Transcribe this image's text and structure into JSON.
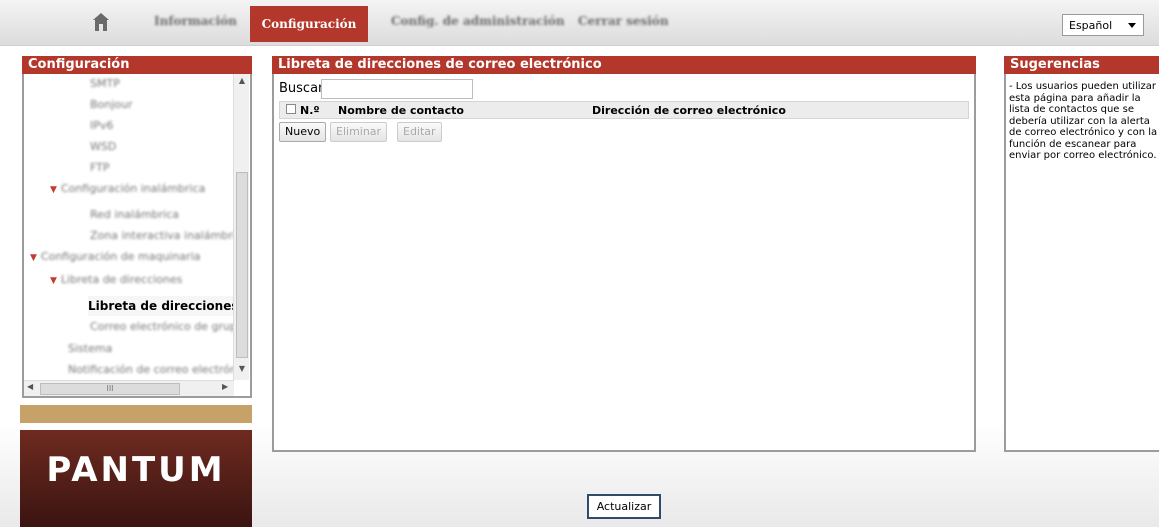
{
  "nav": {
    "home_icon": "home-icon",
    "items": [
      "Información",
      "Configuración",
      "Config. de administración",
      "Cerrar sesión"
    ],
    "active": "Configuración",
    "language": "Español"
  },
  "left": {
    "title": "Configuración",
    "tree": [
      {
        "label": "SMTP",
        "blur": true
      },
      {
        "label": "Bonjour",
        "blur": true
      },
      {
        "label": "IPv6",
        "blur": true
      },
      {
        "label": "WSD",
        "blur": true
      },
      {
        "label": "FTP",
        "blur": true
      },
      {
        "label": "Configuración inalámbrica",
        "blur": true
      },
      {
        "label": "Red inalámbrica",
        "blur": true
      },
      {
        "label": "Zona interactiva inalámbrica",
        "blur": true
      },
      {
        "label": "Configuración de maquinaria",
        "blur": true
      },
      {
        "label": "Libreta de direcciones",
        "blur": true
      },
      {
        "label": "Libreta de direcciones de",
        "blur": false
      },
      {
        "label": "Correo electrónico de grupo",
        "blur": true
      },
      {
        "label": "Sistema",
        "blur": true
      },
      {
        "label": "Notificación de correo electrónico",
        "blur": true
      }
    ],
    "scroll_mark": "III",
    "logo_text": "PANTUM"
  },
  "main": {
    "title": "Libreta de direcciones de correo electrónico",
    "search_label": "Buscar",
    "columns": [
      "N.º",
      "Nombre de contacto",
      "Dirección de correo electrónico"
    ],
    "buttons": {
      "new": "Nuevo",
      "delete": "Eliminar",
      "edit": "Editar"
    }
  },
  "right": {
    "title": "Sugerencias",
    "text": "- Los usuarios pueden utilizar esta página para añadir la lista de contactos que se debería utilizar con la alerta de correo electrónico y con la función de escanear para enviar por correo electrónico."
  },
  "footer": {
    "update": "Actualizar"
  },
  "colors": {
    "accent": "#b3372b",
    "tan": "#c6a268"
  }
}
